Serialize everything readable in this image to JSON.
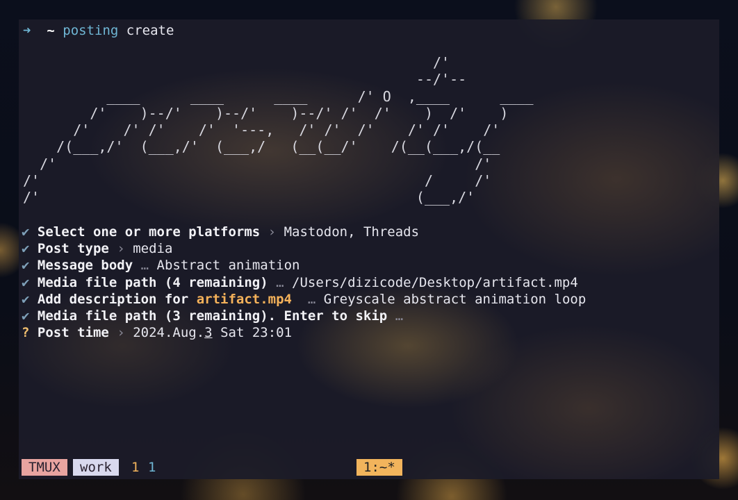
{
  "prompt": {
    "arrow": "➜",
    "dir": "~",
    "command": "posting",
    "argument": "create"
  },
  "ascii_logo": "                                                 /'\n                                               --/'--\n          ____      ____      ____      /' O  ,____      ____\n        /'    )--/'    )--/'    )--/' /'  /'    )  /'    )\n      /'    /' /'    /'  '---,   /' /'  /'    /' /'    /'\n    /(___,/'  (___,/'  (___,/   (__(__/'    /(__(___,/(__\n  /'                                                  /'\n/'                                              /     /'\n/'                                             (___,/'",
  "answers": [
    {
      "status": "✔",
      "question": "Select one or more platforms",
      "separator": "›",
      "answer": "Mastodon, Threads"
    },
    {
      "status": "✔",
      "question": "Post type",
      "separator": "›",
      "answer": "media"
    },
    {
      "status": "✔",
      "question": "Message body",
      "separator": "…",
      "answer": "Abstract animation"
    },
    {
      "status": "✔",
      "question": "Media file path (4 remaining)",
      "separator": "…",
      "answer": "/Users/dizicode/Desktop/artifact.mp4"
    },
    {
      "status": "✔",
      "question_prefix": "Add description for",
      "question_highlight": "artifact.mp4",
      "separator": "…",
      "answer": "Greyscale abstract animation loop"
    },
    {
      "status": "✔",
      "question": "Media file path (3 remaining). Enter to skip",
      "separator": "…",
      "answer": ""
    },
    {
      "status": "?",
      "question": "Post time",
      "separator": "›",
      "answer_before": "2024.Aug.",
      "answer_cursor": "3",
      "answer_after": " Sat 23:01"
    }
  ],
  "statusbar": {
    "tmux_label": "TMUX",
    "session": "work",
    "count_a": "1",
    "count_b": "1",
    "window": "1:~*"
  },
  "colors": {
    "accent_cyan": "#6fb6d4",
    "accent_orange": "#f5b25a",
    "tmux_pink": "#e8a4a0",
    "session_lavender": "#d9d9ee"
  }
}
